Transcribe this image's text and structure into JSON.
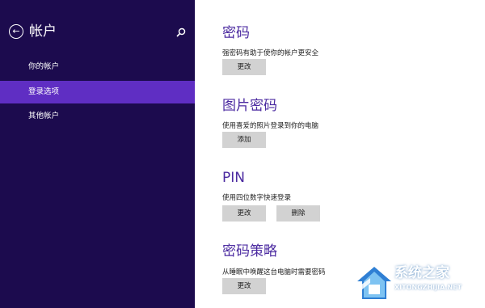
{
  "sidebar": {
    "title": "帐户",
    "back_icon": "back-arrow-icon",
    "search_icon": "search-icon",
    "items": [
      {
        "label": "你的帐户",
        "selected": false
      },
      {
        "label": "登录选项",
        "selected": true
      },
      {
        "label": "其他帐户",
        "selected": false
      }
    ]
  },
  "sections": {
    "password": {
      "title": "密码",
      "desc": "强密码有助于使你的帐户更安全",
      "button": "更改"
    },
    "picture_password": {
      "title": "图片密码",
      "desc": "使用喜爱的照片登录到你的电脑",
      "button": "添加"
    },
    "pin": {
      "title": "PIN",
      "desc": "使用四位数字快速登录",
      "change_button": "更改",
      "delete_button": "删除"
    },
    "password_policy": {
      "title": "密码策略",
      "desc": "从睡眠中唤醒这台电脑时需要密码",
      "button": "更改"
    }
  },
  "watermark": {
    "text": "系统之家",
    "url": "XITONGZHIJIA.NET"
  },
  "colors": {
    "sidebar_bg": "#1c0b4e",
    "selected_bg": "#5f2ec3",
    "heading": "#4b2aa0",
    "button_bg": "#d2d2d2"
  }
}
